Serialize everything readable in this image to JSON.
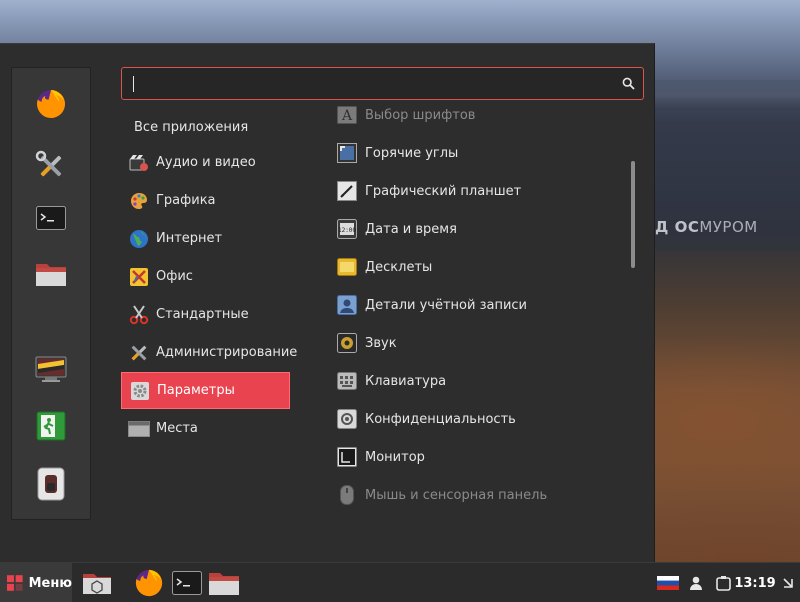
{
  "wallpaper": {
    "watermark_lead": "Д ОС",
    "watermark_tail": "МУРОМ"
  },
  "menu": {
    "search": {
      "value": "",
      "placeholder": ""
    },
    "all_apps_label": "Все приложения",
    "favorites": [
      {
        "name": "firefox",
        "icon": "firefox-icon"
      },
      {
        "name": "system-tools",
        "icon": "tools-icon"
      },
      {
        "name": "terminal",
        "icon": "terminal-icon"
      },
      {
        "name": "files",
        "icon": "folder-icon"
      },
      {
        "name": "lock-screen",
        "icon": "lock-screen-icon"
      },
      {
        "name": "logout",
        "icon": "logout-icon"
      },
      {
        "name": "shutdown",
        "icon": "power-switch-icon"
      }
    ],
    "categories": [
      {
        "label": "Аудио и видео",
        "icon": "multimedia-icon"
      },
      {
        "label": "Графика",
        "icon": "graphics-icon"
      },
      {
        "label": "Интернет",
        "icon": "globe-icon"
      },
      {
        "label": "Офис",
        "icon": "office-icon"
      },
      {
        "label": "Стандартные",
        "icon": "scissors-icon"
      },
      {
        "label": "Администрирование",
        "icon": "admin-tools-icon"
      },
      {
        "label": "Параметры",
        "icon": "settings-icon",
        "active": true
      },
      {
        "label": "Места",
        "icon": "places-icon"
      }
    ],
    "apps": [
      {
        "label": "Выбор шрифтов",
        "icon": "font-icon",
        "dim": true
      },
      {
        "label": "Горячие углы",
        "icon": "hot-corners-icon"
      },
      {
        "label": "Графический планшет",
        "icon": "tablet-icon"
      },
      {
        "label": "Дата и время",
        "icon": "clock-icon"
      },
      {
        "label": "Десклеты",
        "icon": "desklets-icon"
      },
      {
        "label": "Детали учётной записи",
        "icon": "user-icon"
      },
      {
        "label": "Звук",
        "icon": "speaker-icon"
      },
      {
        "label": "Клавиатура",
        "icon": "keyboard-icon"
      },
      {
        "label": "Конфиденциальность",
        "icon": "privacy-icon"
      },
      {
        "label": "Монитор",
        "icon": "monitor-icon"
      },
      {
        "label": "Мышь и сенсорная панель",
        "icon": "mouse-icon",
        "dim": true
      }
    ]
  },
  "panel": {
    "menu_label": "Меню",
    "clock": "13:19",
    "launchers": [
      "show-desktop-icon",
      "firefox-icon",
      "terminal-icon",
      "folder-icon"
    ],
    "tray": [
      "russian-flag-icon",
      "user-applet-icon",
      "notifications-icon",
      "window-list-icon"
    ]
  },
  "colors": {
    "accent": "#e8434f",
    "search_border": "#d9534f",
    "menu_bg": "#2d2d2d",
    "panel_bg": "#2b2b2b"
  }
}
